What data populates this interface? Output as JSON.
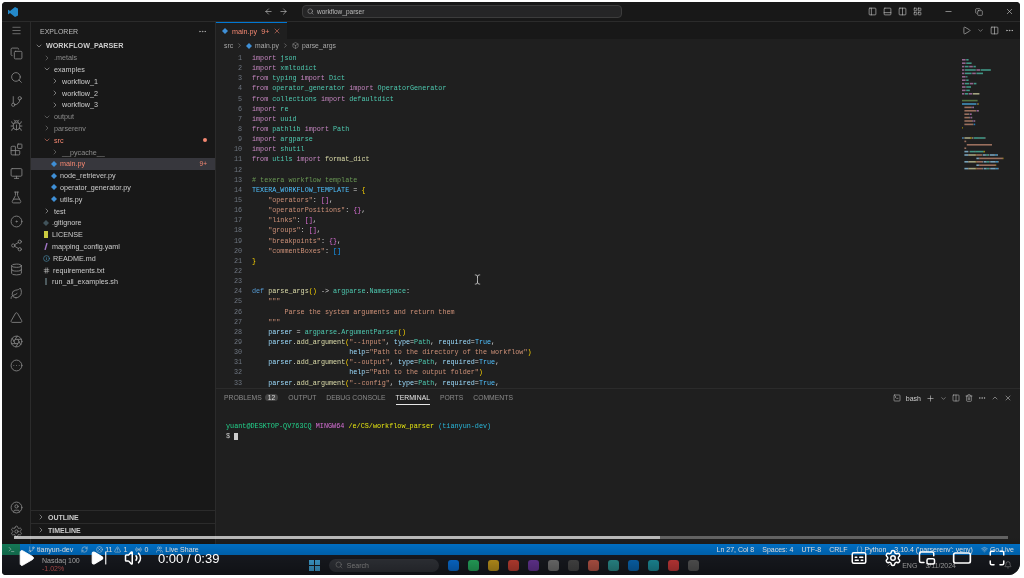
{
  "title_bar": {
    "search": "workflow_parser"
  },
  "sidebar": {
    "title": "EXPLORER",
    "root": {
      "label": "WORKFLOW_PARSER",
      "expanded": true,
      "children": [
        {
          "label": ".metals",
          "kind": "folder",
          "expanded": false,
          "selected": false,
          "dimmed": true,
          "error": false
        },
        {
          "label": "examples",
          "kind": "folder",
          "expanded": true,
          "selected": false,
          "dimmed": false,
          "error": false,
          "children": [
            {
              "label": "workflow_1",
              "kind": "folder",
              "expanded": false,
              "selected": false,
              "dimmed": false,
              "error": false
            },
            {
              "label": "workflow_2",
              "kind": "folder",
              "expanded": false,
              "selected": false,
              "dimmed": false,
              "error": false
            },
            {
              "label": "workflow_3",
              "kind": "folder",
              "expanded": false,
              "selected": false,
              "dimmed": false,
              "error": false
            }
          ]
        },
        {
          "label": "output",
          "kind": "folder",
          "expanded": true,
          "selected": false,
          "dimmed": true,
          "error": false
        },
        {
          "label": "parserenv",
          "kind": "folder",
          "expanded": false,
          "selected": false,
          "dimmed": true,
          "error": false
        },
        {
          "label": "src",
          "kind": "folder",
          "expanded": true,
          "selected": false,
          "dimmed": false,
          "error": true,
          "children": [
            {
              "label": "__pycache__",
              "kind": "folder",
              "expanded": false,
              "selected": false,
              "dimmed": true,
              "error": false
            },
            {
              "label": "main.py",
              "kind": "py",
              "selected": true,
              "dimmed": false,
              "error": true,
              "badge": "9+"
            },
            {
              "label": "node_retriever.py",
              "kind": "py",
              "selected": false,
              "dimmed": false,
              "error": false
            },
            {
              "label": "operator_generator.py",
              "kind": "py",
              "selected": false,
              "dimmed": false,
              "error": false
            },
            {
              "label": "utils.py",
              "kind": "py",
              "selected": false,
              "dimmed": false,
              "error": false
            }
          ]
        },
        {
          "label": "test",
          "kind": "folder",
          "expanded": false,
          "selected": false,
          "dimmed": false,
          "error": false
        },
        {
          "label": ".gitignore",
          "kind": "git",
          "selected": false,
          "dimmed": false,
          "error": false
        },
        {
          "label": "LICENSE",
          "kind": "license",
          "selected": false,
          "dimmed": false,
          "error": false
        },
        {
          "label": "mapping_config.yaml",
          "kind": "yaml",
          "selected": false,
          "dimmed": false,
          "error": false
        },
        {
          "label": "README.md",
          "kind": "md",
          "selected": false,
          "dimmed": false,
          "error": false
        },
        {
          "label": "requirements.txt",
          "kind": "txt",
          "selected": false,
          "dimmed": false,
          "error": false
        },
        {
          "label": "run_all_examples.sh",
          "kind": "sh",
          "selected": false,
          "dimmed": false,
          "error": false
        }
      ]
    },
    "sections": [
      {
        "label": "OUTLINE",
        "expanded": false
      },
      {
        "label": "TIMELINE",
        "expanded": false
      }
    ]
  },
  "editor": {
    "tabs": [
      {
        "label": "main.py",
        "badge": "9+",
        "selected": true,
        "error": true
      }
    ],
    "breadcrumb": [
      "src",
      "main.py",
      "parse_args"
    ],
    "lines": [
      {
        "n": "1",
        "tokens": [
          {
            "text": "import",
            "kind": "kw"
          },
          {
            "text": " json",
            "kind": "mod"
          }
        ]
      },
      {
        "n": "2",
        "tokens": [
          {
            "text": "import",
            "kind": "kw"
          },
          {
            "text": " xmltodict",
            "kind": "mod"
          }
        ]
      },
      {
        "n": "3",
        "tokens": [
          {
            "text": "from",
            "kind": "kw"
          },
          {
            "text": " typing ",
            "kind": "mod"
          },
          {
            "text": "import",
            "kind": "kw"
          },
          {
            "text": " Dict",
            "kind": "cls"
          }
        ]
      },
      {
        "n": "4",
        "tokens": [
          {
            "text": "from",
            "kind": "kw"
          },
          {
            "text": " operator_generator ",
            "kind": "mod"
          },
          {
            "text": "import",
            "kind": "kw"
          },
          {
            "text": " OperatorGenerator",
            "kind": "cls"
          }
        ]
      },
      {
        "n": "5",
        "tokens": [
          {
            "text": "from",
            "kind": "kw"
          },
          {
            "text": " collections ",
            "kind": "mod"
          },
          {
            "text": "import",
            "kind": "kw"
          },
          {
            "text": " defaultdict",
            "kind": "cls"
          }
        ]
      },
      {
        "n": "6",
        "tokens": [
          {
            "text": "import",
            "kind": "kw"
          },
          {
            "text": " re",
            "kind": "mod"
          }
        ]
      },
      {
        "n": "7",
        "tokens": [
          {
            "text": "import",
            "kind": "kw"
          },
          {
            "text": " uuid",
            "kind": "mod"
          }
        ]
      },
      {
        "n": "8",
        "tokens": [
          {
            "text": "from",
            "kind": "kw"
          },
          {
            "text": " pathlib ",
            "kind": "mod"
          },
          {
            "text": "import",
            "kind": "kw"
          },
          {
            "text": " Path",
            "kind": "cls"
          }
        ]
      },
      {
        "n": "9",
        "tokens": [
          {
            "text": "import",
            "kind": "kw"
          },
          {
            "text": " argparse",
            "kind": "mod"
          }
        ]
      },
      {
        "n": "10",
        "tokens": [
          {
            "text": "import",
            "kind": "kw"
          },
          {
            "text": " shutil",
            "kind": "mod"
          }
        ]
      },
      {
        "n": "11",
        "tokens": [
          {
            "text": "from",
            "kind": "kw"
          },
          {
            "text": " utils ",
            "kind": "mod"
          },
          {
            "text": "import",
            "kind": "kw"
          },
          {
            "text": " format_dict",
            "kind": "fn"
          }
        ]
      },
      {
        "n": "12"
      },
      {
        "n": "13",
        "tokens": [
          {
            "text": "# texera workflow template",
            "kind": "com"
          }
        ]
      },
      {
        "n": "14",
        "tokens": [
          {
            "text": "TEXERA_WORKFLOW_TEMPLATE",
            "kind": "const"
          },
          {
            "text": " = ",
            "kind": "op"
          },
          {
            "text": "{",
            "kind": "b1"
          }
        ]
      },
      {
        "n": "15",
        "tokens": [
          {
            "text": "    \"operators\"",
            "kind": "str"
          },
          {
            "text": ": ",
            "kind": "op"
          },
          {
            "text": "[]",
            "kind": "b2"
          },
          {
            "text": ",",
            "kind": "op"
          }
        ]
      },
      {
        "n": "16",
        "tokens": [
          {
            "text": "    \"operatorPositions\"",
            "kind": "str"
          },
          {
            "text": ": ",
            "kind": "op"
          },
          {
            "text": "{}",
            "kind": "b2"
          },
          {
            "text": ",",
            "kind": "op"
          }
        ]
      },
      {
        "n": "17",
        "tokens": [
          {
            "text": "    \"links\"",
            "kind": "str"
          },
          {
            "text": ": ",
            "kind": "op"
          },
          {
            "text": "[]",
            "kind": "b2"
          },
          {
            "text": ",",
            "kind": "op"
          }
        ]
      },
      {
        "n": "18",
        "tokens": [
          {
            "text": "    \"groups\"",
            "kind": "str"
          },
          {
            "text": ": ",
            "kind": "op"
          },
          {
            "text": "[]",
            "kind": "b2"
          },
          {
            "text": ",",
            "kind": "op"
          }
        ]
      },
      {
        "n": "19",
        "tokens": [
          {
            "text": "    \"breakpoints\"",
            "kind": "str"
          },
          {
            "text": ": ",
            "kind": "op"
          },
          {
            "text": "{}",
            "kind": "b2"
          },
          {
            "text": ",",
            "kind": "op"
          }
        ]
      },
      {
        "n": "20",
        "tokens": [
          {
            "text": "    \"commentBoxes\"",
            "kind": "str"
          },
          {
            "text": ": ",
            "kind": "op"
          },
          {
            "text": "[]",
            "kind": "b3"
          }
        ]
      },
      {
        "n": "21",
        "tokens": [
          {
            "text": "}",
            "kind": "b1"
          }
        ]
      },
      {
        "n": "22"
      },
      {
        "n": "23"
      },
      {
        "n": "24",
        "tokens": [
          {
            "text": "def",
            "kind": "def"
          },
          {
            "text": " parse_args",
            "kind": "fn"
          },
          {
            "text": "()",
            "kind": "b1"
          },
          {
            "text": " -> ",
            "kind": "op"
          },
          {
            "text": "argparse",
            "kind": "mod"
          },
          {
            "text": ".",
            "kind": "op"
          },
          {
            "text": "Namespace",
            "kind": "cls"
          },
          {
            "text": ":",
            "kind": "op"
          }
        ]
      },
      {
        "n": "25",
        "tokens": [
          {
            "text": "    \"\"\"",
            "kind": "str"
          }
        ]
      },
      {
        "n": "26",
        "tokens": [
          {
            "text": "        Parse the system arguments and return them",
            "kind": "str"
          }
        ]
      },
      {
        "n": "27",
        "tokens": [
          {
            "text": "    \"\"\"",
            "kind": "str"
          }
        ]
      },
      {
        "n": "28",
        "tokens": [
          {
            "text": "    parser",
            "kind": "var"
          },
          {
            "text": " = ",
            "kind": "op"
          },
          {
            "text": "argparse",
            "kind": "mod"
          },
          {
            "text": ".",
            "kind": "op"
          },
          {
            "text": "ArgumentParser",
            "kind": "cls"
          },
          {
            "text": "()",
            "kind": "b1"
          }
        ]
      },
      {
        "n": "29",
        "tokens": [
          {
            "text": "    parser",
            "kind": "var"
          },
          {
            "text": ".",
            "kind": "op"
          },
          {
            "text": "add_argument",
            "kind": "fn"
          },
          {
            "text": "(",
            "kind": "b1"
          },
          {
            "text": "\"--input\"",
            "kind": "str"
          },
          {
            "text": ", ",
            "kind": "op"
          },
          {
            "text": "type",
            "kind": "var"
          },
          {
            "text": "=",
            "kind": "op"
          },
          {
            "text": "Path",
            "kind": "cls"
          },
          {
            "text": ", ",
            "kind": "op"
          },
          {
            "text": "required",
            "kind": "var"
          },
          {
            "text": "=",
            "kind": "op"
          },
          {
            "text": "True",
            "kind": "const"
          },
          {
            "text": ",",
            "kind": "op"
          }
        ]
      },
      {
        "n": "30",
        "tokens": [
          {
            "text": "                        help",
            "kind": "var"
          },
          {
            "text": "=",
            "kind": "op"
          },
          {
            "text": "\"Path to the directory of the workflow\"",
            "kind": "str"
          },
          {
            "text": ")",
            "kind": "b1"
          }
        ]
      },
      {
        "n": "31",
        "tokens": [
          {
            "text": "    parser",
            "kind": "var"
          },
          {
            "text": ".",
            "kind": "op"
          },
          {
            "text": "add_argument",
            "kind": "fn"
          },
          {
            "text": "(",
            "kind": "b1"
          },
          {
            "text": "\"--output\"",
            "kind": "str"
          },
          {
            "text": ", ",
            "kind": "op"
          },
          {
            "text": "type",
            "kind": "var"
          },
          {
            "text": "=",
            "kind": "op"
          },
          {
            "text": "Path",
            "kind": "cls"
          },
          {
            "text": ", ",
            "kind": "op"
          },
          {
            "text": "required",
            "kind": "var"
          },
          {
            "text": "=",
            "kind": "op"
          },
          {
            "text": "True",
            "kind": "const"
          },
          {
            "text": ",",
            "kind": "op"
          }
        ]
      },
      {
        "n": "32",
        "tokens": [
          {
            "text": "                        help",
            "kind": "var"
          },
          {
            "text": "=",
            "kind": "op"
          },
          {
            "text": "\"Path to the output folder\"",
            "kind": "str"
          },
          {
            "text": ")",
            "kind": "b1"
          }
        ]
      },
      {
        "n": "33",
        "tokens": [
          {
            "text": "    parser",
            "kind": "var"
          },
          {
            "text": ".",
            "kind": "op"
          },
          {
            "text": "add_argument",
            "kind": "fn"
          },
          {
            "text": "(",
            "kind": "b1"
          },
          {
            "text": "\"--config\"",
            "kind": "str"
          },
          {
            "text": ", ",
            "kind": "op"
          },
          {
            "text": "type",
            "kind": "var"
          },
          {
            "text": "=",
            "kind": "op"
          },
          {
            "text": "Path",
            "kind": "cls"
          },
          {
            "text": ", ",
            "kind": "op"
          },
          {
            "text": "required",
            "kind": "var"
          },
          {
            "text": "=",
            "kind": "op"
          },
          {
            "text": "True",
            "kind": "const"
          },
          {
            "text": ",",
            "kind": "op"
          }
        ]
      }
    ]
  },
  "panel": {
    "tabs": [
      {
        "label": "PROBLEMS",
        "badge": "12",
        "selected": false
      },
      {
        "label": "OUTPUT",
        "selected": false
      },
      {
        "label": "DEBUG CONSOLE",
        "selected": false
      },
      {
        "label": "TERMINAL",
        "selected": true
      },
      {
        "label": "PORTS",
        "selected": false
      },
      {
        "label": "COMMENTS",
        "selected": false
      }
    ],
    "terminal_name": "bash",
    "prompt": {
      "user": "yuant@DESKTOP-QV763CQ",
      "system": "MINGW64",
      "path": "/e/CS/workflow_parser",
      "branch": "(tianyun-dev)"
    },
    "input_prompt": "$"
  },
  "status_bar": {
    "branch": "tianyun-dev",
    "errors": "11",
    "warnings": "1",
    "ports": "0",
    "live_share": "Live Share",
    "right": [
      "Ln 27, Col 8",
      "Spaces: 4",
      "UTF-8",
      "CRLF",
      "Python",
      "3.10.4 ('parserenv': venv)",
      "Go Live"
    ]
  },
  "taskbar": {
    "widget": {
      "title": "Nasdaq 100",
      "change": "-1.02%"
    },
    "search": "Search",
    "language": "ENG",
    "date": "3/11/2024"
  },
  "player": {
    "progress": {
      "level": 0
    },
    "time": "0:00 / 0:39"
  }
}
